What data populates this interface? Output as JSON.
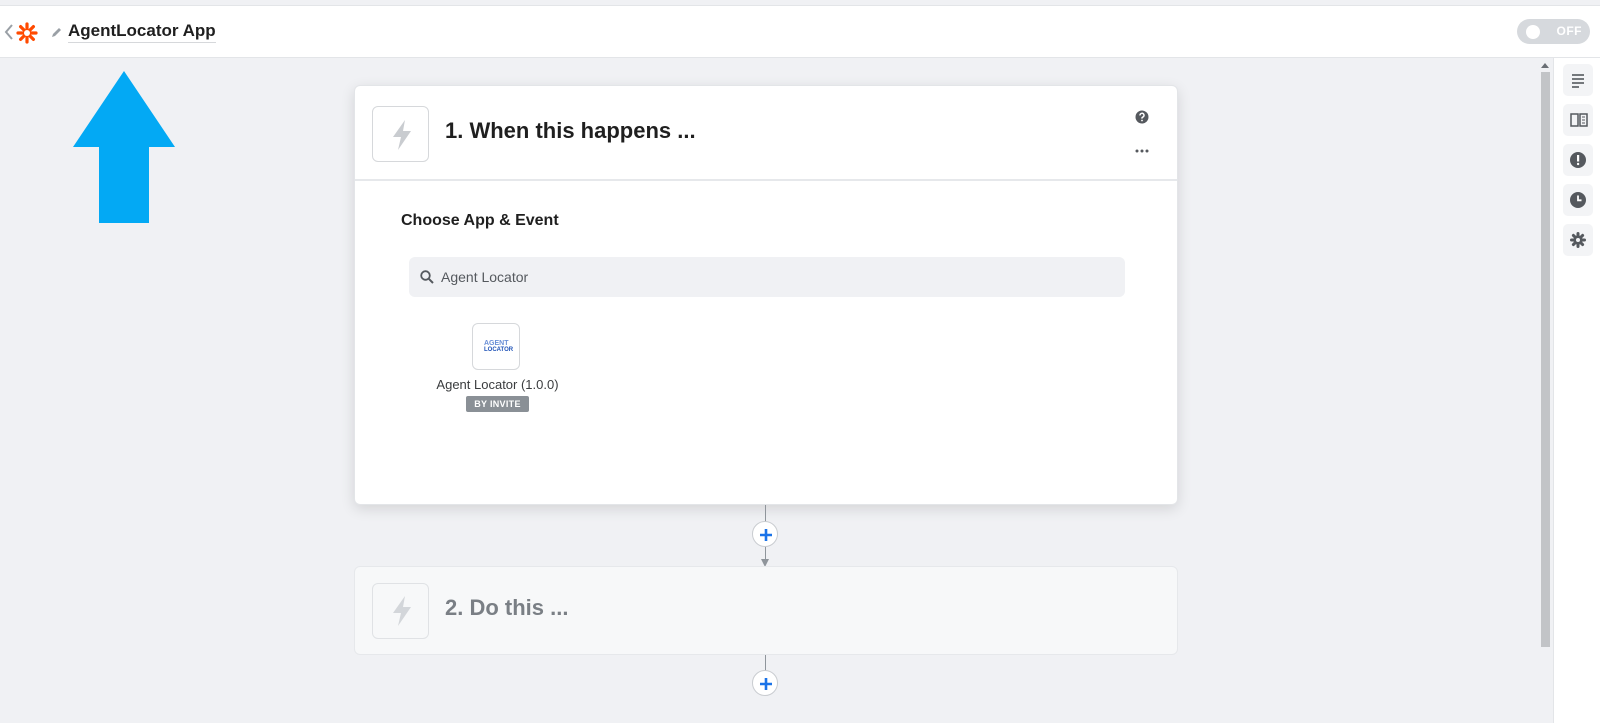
{
  "header": {
    "zap_title": "AgentLocator App",
    "toggle_label": "OFF",
    "brand_color": "#ff4a00"
  },
  "step1": {
    "title": "1. When this happens ...",
    "section_title": "Choose App & Event",
    "search": {
      "value": "Agent Locator"
    },
    "app_result": {
      "logo_line1": "AGENT",
      "logo_line2": "LOCATOR",
      "name": "Agent Locator (1.0.0)",
      "badge": "BY INVITE"
    }
  },
  "step2": {
    "title": "2. Do this ..."
  },
  "icons": {
    "back": "chevron-left-icon",
    "logo": "zapier-logo-icon",
    "edit": "pencil-icon",
    "help": "help-circle-icon",
    "more": "more-horizontal-icon",
    "trigger": "lightning-bolt-icon",
    "search": "search-icon",
    "add": "plus-icon",
    "rail": [
      "details-icon",
      "guide-book-icon",
      "alert-icon",
      "history-clock-icon",
      "settings-gear-icon"
    ]
  },
  "annotation_color": "#03a9f4"
}
